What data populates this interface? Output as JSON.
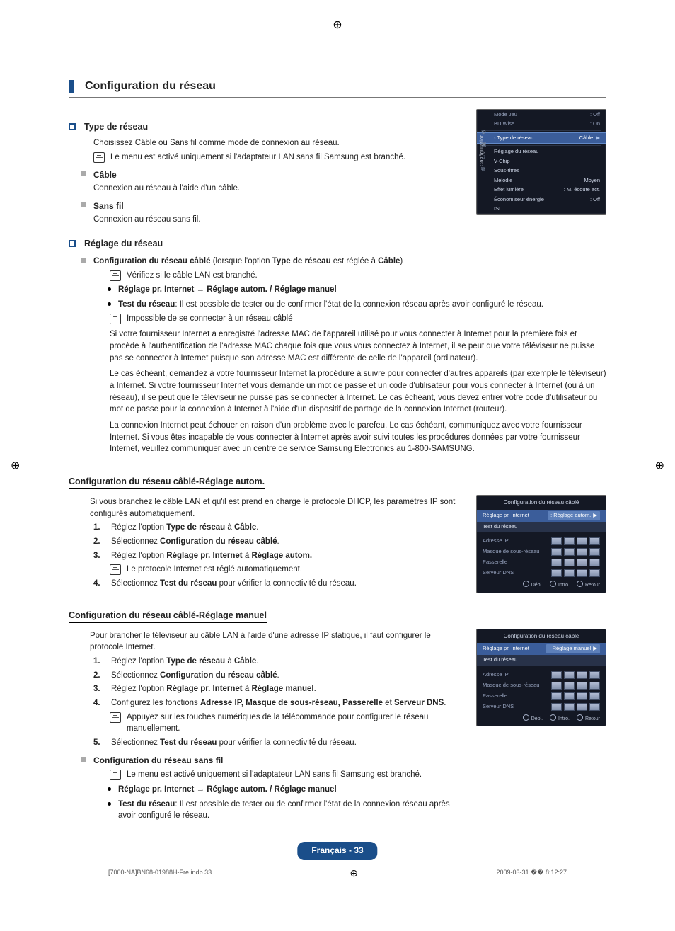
{
  "main_heading": "Configuration du réseau",
  "sec_type": {
    "title": "Type de réseau",
    "desc": "Choisissez Câble ou Sans fil comme mode de connexion au réseau.",
    "note1": "Le menu est activé uniquement si l'adaptateur LAN sans fil Samsung est branché.",
    "items": [
      {
        "label": "Câble",
        "desc": "Connexion au réseau à l'aide d'un câble."
      },
      {
        "label": "Sans fil",
        "desc": "Connexion au réseau sans fil."
      }
    ]
  },
  "sec_reglage": {
    "title": "Réglage du réseau",
    "item1_line": "Configuration du réseau câblé (lorsque l'option Type de réseau est réglée à Câble)",
    "item1_label_bold_a": "Configuration du réseau câblé",
    "item1_mid": " (lorsque l'option ",
    "item1_label_bold_b": "Type de réseau",
    "item1_tail": " est réglée à ",
    "item1_label_bold_c": "Câble",
    "item1_close": ")",
    "note_verify": "Vérifiez si le câble LAN est branché.",
    "dot1": "Réglage pr. Internet → Réglage autom. / Réglage manuel",
    "dot2_bold": "Test du réseau",
    "dot2_rest": ": Il est possible de tester ou de confirmer l'état de la connexion réseau après avoir configuré le réseau.",
    "note_imposs": "Impossible de se connecter à un réseau câblé",
    "para1": "Si votre fournisseur Internet a enregistré l'adresse MAC de l'appareil utilisé pour vous connecter à Internet pour la première fois et procède à l'authentification de l'adresse MAC chaque fois que vous vous connectez à Internet, il se peut que votre téléviseur ne puisse pas se connecter à Internet puisque son adresse MAC est différente de celle de l'appareil (ordinateur).",
    "para2": "Le cas échéant, demandez à votre fournisseur Internet la procédure à suivre pour connecter d'autres appareils (par exemple le téléviseur) à Internet. Si votre fournisseur Internet vous demande un mot de passe et un code d'utilisateur pour vous connecter à Internet (ou à un réseau), il se peut que le téléviseur ne puisse pas se connecter à Internet. Le cas échéant, vous devez entrer votre code d'utilisateur ou mot de passe pour la connexion à Internet à l'aide d'un dispositif de partage de la connexion Internet (routeur).",
    "para3": "La connexion Internet peut échouer en raison d'un problème avec le parefeu. Le cas échéant, communiquez avec votre fournisseur Internet. Si vous êtes incapable de vous connecter à Internet après avoir suivi toutes les procédures données par votre fournisseur Internet, veuillez communiquer avec un centre de service Samsung Electronics au 1-800-SAMSUNG."
  },
  "sec_autom": {
    "title": "Configuration du réseau câblé-Réglage autom.",
    "intro": "Si vous branchez le câble LAN et qu'il est prend en charge le protocole DHCP, les paramètres IP sont configurés automatiquement.",
    "steps": [
      "Réglez l'option Type de réseau à Câble.",
      "Sélectionnez Configuration du réseau câblé.",
      "Réglez l'option Réglage pr. Internet à Réglage autom.",
      "Sélectionnez Test du réseau pour vérifier la connectivité du réseau."
    ],
    "step3_note": "Le protocole Internet est réglé automatiquement."
  },
  "sec_manuel": {
    "title": "Configuration du réseau câblé-Réglage manuel",
    "intro": "Pour brancher le téléviseur au câble LAN à l'aide d'une adresse IP statique, il faut configurer le protocole Internet.",
    "steps": [
      "Réglez l'option Type de réseau à Câble.",
      "Sélectionnez Configuration du réseau câblé.",
      "Réglez l'option Réglage pr. Internet à Réglage manuel.",
      "Configurez les fonctions Adresse IP, Masque de sous-réseau, Passerelle et Serveur DNS.",
      "Sélectionnez Test du réseau pour vérifier la connectivité du réseau."
    ],
    "step4_note": "Appuyez sur les touches numériques de la télécommande pour configurer le réseau manuellement."
  },
  "sec_sansfil": {
    "label": "Configuration du réseau sans fil",
    "note": "Le menu est activé uniquement si l'adaptateur LAN sans fil Samsung est branché.",
    "dot1": "Réglage pr. Internet → Réglage autom. / Réglage manuel",
    "dot2_bold": "Test du réseau",
    "dot2_rest": ": Il est possible de tester ou de confirmer l'état de la connexion réseau après avoir configuré le réseau."
  },
  "osd_main": {
    "side": "Configuration",
    "rows": [
      {
        "lbl": "Mode Jeu",
        "val": ": Off",
        "dim": true
      },
      {
        "lbl": "BD Wise",
        "val": ": On",
        "dim": true
      },
      {
        "lbl": "Type de réseau",
        "val": ": Câble",
        "hl": true,
        "arrow": "▶"
      },
      {
        "lbl": "Réglage du réseau"
      },
      {
        "lbl": "V-Chip"
      },
      {
        "lbl": "Sous-titres"
      },
      {
        "lbl": "Mélodie",
        "val": ": Moyen"
      },
      {
        "lbl": "Effet lumière",
        "val": ": M. écoute act."
      },
      {
        "lbl": "Économiseur énergie",
        "val": ": Off"
      },
      {
        "lbl": "ISI"
      }
    ]
  },
  "cfgbox": {
    "title": "Configuration du réseau câblé",
    "reglage_label": "Réglage pr. Internet",
    "sel_autom": "Réglage autom.",
    "sel_manuel": "Réglage manuel",
    "test": "Test du réseau",
    "fields": [
      "Adresse IP",
      "Masque de sous-réseau",
      "Passerelle",
      "Serveur DNS"
    ],
    "footer": [
      "Dépl.",
      "Intro.",
      "Retour"
    ]
  },
  "page_badge": "Français - 33",
  "print_footer": {
    "left": "[7000-NA]BN68-01988H-Fre.indb   33",
    "right": "2009-03-31   �� 8:12:27"
  }
}
